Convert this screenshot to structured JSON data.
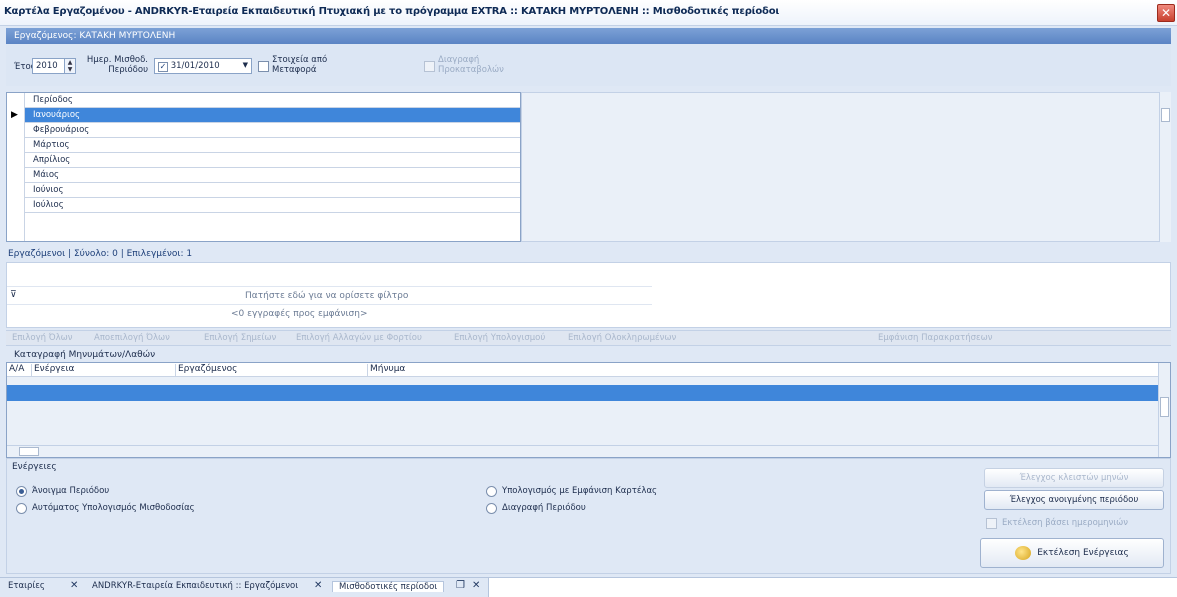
{
  "window": {
    "title": "Καρτέλα Εργαζομένου - ANDRKYR-Εταιρεία Εκπαιδευτική Πτυχιακή με το πρόγραμμα EXTRA :: ΚΑΤΑΚΗ ΜΥΡΤΟΛΕΝΗ :: Μισθοδοτικές περίοδοι",
    "close_glyph": "✕"
  },
  "employee_bar": {
    "label": "Εργαζόμενος: ΚΑΤΑΚΗ ΜΥΡΤΟΛΕΝΗ"
  },
  "filters": {
    "year_label": "Έτος",
    "year_value": "2010",
    "date_label": "Ημερ. Μισθοδ. Περιόδου",
    "date_value": "31/01/2010",
    "transfer_label": "Στοιχεία από Μεταφορά",
    "delete_prev_label": "Διαγραφή Προκαταβολών"
  },
  "periods": {
    "header": "Περίοδος",
    "rows": [
      "Ιανουάριος",
      "Φεβρουάριος",
      "Μάρτιος",
      "Απρίλιος",
      "Μάιος",
      "Ιούνιος",
      "Ιούλιος"
    ]
  },
  "employees": {
    "summary": "Εργαζόμενοι | Σύνολο: 0 | Επιλεγμένοι: 1",
    "filter_hint": "Πατήστε εδώ για να ορίσετε φίλτρο",
    "records_hint": "<0 εγγραφές προς εμφάνιση>"
  },
  "toolbar": {
    "items": [
      "Επιλογή Όλων",
      "Αποεπιλογή Όλων",
      "Επιλογή Σημείων",
      "Επιλογή Αλλαγών με Φορτίου",
      "Επιλογή Υπολογισμού",
      "Επιλογή Ολοκληρωμένων"
    ],
    "right_item": "Εμφάνιση Παρακρατήσεων"
  },
  "messages": {
    "title": "Καταγραφή Μηνυμάτων/Λαθών",
    "columns": [
      "Α/Α",
      "Ενέργεια",
      "Εργαζόμενος",
      "Μήνυμα"
    ]
  },
  "actions": {
    "title": "Ενέργειες",
    "options": [
      {
        "label": "Άνοιγμα Περιόδου",
        "selected": true
      },
      {
        "label": "Αυτόματος Υπολογισμός Μισθοδοσίας",
        "selected": false
      },
      {
        "label": "Υπολογισμός με Εμφάνιση Καρτέλας",
        "selected": false
      },
      {
        "label": "Διαγραφή Περιόδου",
        "selected": false
      }
    ],
    "btn_check_params": "Έλεγχος κλειστών μηνών",
    "btn_check_period": "Έλεγχος ανοιγμένης περιόδου",
    "chk_batch": "Εκτέλεση βάσει ημερομηνιών",
    "btn_run": "Εκτέλεση Ενέργειας"
  },
  "tabs": {
    "items": [
      "Εταιρίες",
      "ANDRKYR-Εταιρεία Εκπαιδευτική :: Εργαζόμενοι",
      "Μισθοδοτικές περίοδοι"
    ]
  }
}
